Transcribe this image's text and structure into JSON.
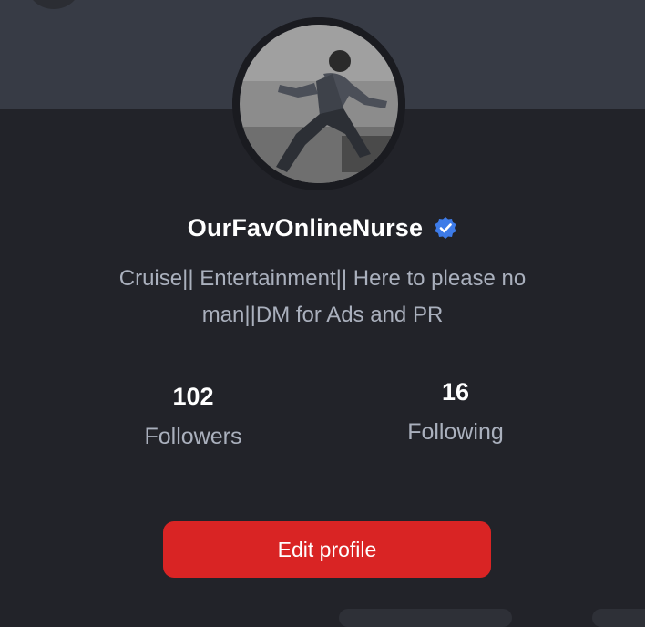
{
  "profile": {
    "username": "OurFavOnlineNurse",
    "verified_icon": "verified-badge-icon",
    "bio_line1": "Cruise|| Entertainment|| Here to please no",
    "bio_line2": "man||DM for Ads and PR"
  },
  "stats": {
    "followers_count": "102",
    "followers_label": "Followers",
    "following_count": "16",
    "following_label": "Following"
  },
  "actions": {
    "edit_profile_label": "Edit profile"
  },
  "colors": {
    "background": "#222329",
    "cover": "#373b45",
    "accent_button": "#d92424",
    "verified_badge": "#3d7be8",
    "secondary_text": "#aab0bd"
  }
}
